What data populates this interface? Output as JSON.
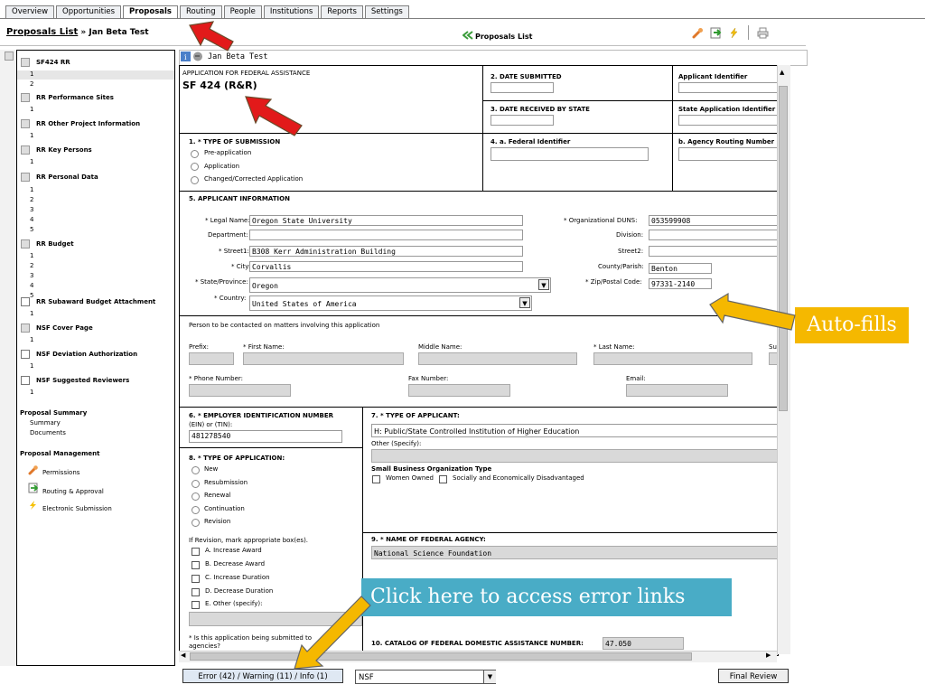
{
  "tabs": [
    "Overview",
    "Opportunities",
    "Proposals",
    "Routing",
    "People",
    "Institutions",
    "Reports",
    "Settings"
  ],
  "active_tab": "Proposals",
  "breadcrumb": {
    "link": "Proposals List",
    "separator": " » ",
    "current": "Jan Beta Test"
  },
  "proposals_link": "Proposals List",
  "proposal_title": "Jan Beta Test",
  "sidebar": {
    "forms": [
      {
        "label": "SF424 RR",
        "rows": [
          "1",
          "2"
        ]
      },
      {
        "label": "RR Performance Sites",
        "rows": [
          "1"
        ]
      },
      {
        "label": "RR Other Project Information",
        "rows": [
          "1"
        ]
      },
      {
        "label": "RR Key Persons",
        "rows": [
          "1"
        ]
      },
      {
        "label": "RR Personal Data",
        "rows": [
          "1",
          "2",
          "3",
          "4",
          "5"
        ]
      },
      {
        "label": "RR Budget",
        "rows": [
          "1",
          "2",
          "3",
          "4",
          "5"
        ]
      },
      {
        "label": "RR Subaward Budget Attachment",
        "rows": [
          "1"
        ]
      },
      {
        "label": "NSF Cover Page",
        "rows": [
          "1"
        ]
      },
      {
        "label": "NSF Deviation Authorization",
        "rows": [
          "1"
        ]
      },
      {
        "label": "NSF Suggested Reviewers",
        "rows": [
          "1"
        ]
      }
    ],
    "summary_title": "Proposal Summary",
    "summary_items": [
      "Summary",
      "Documents"
    ],
    "management_title": "Proposal Management",
    "management_items": [
      "Permissions",
      "Routing & Approval",
      "Electronic Submission"
    ]
  },
  "form": {
    "app_title": "APPLICATION FOR FEDERAL ASSISTANCE",
    "app_form": "SF 424 (R&R)",
    "date_submitted": "2. DATE SUBMITTED",
    "applicant_identifier": "Applicant Identifier",
    "date_received": "3. DATE RECEIVED BY STATE",
    "state_app_id": "State Application Identifier",
    "type_submission": "1. * TYPE OF SUBMISSION",
    "submission_options": [
      "Pre-application",
      "Application",
      "Changed/Corrected Application"
    ],
    "federal_identifier": "4. a. Federal Identifier",
    "agency_routing": "b. Agency Routing Number",
    "applicant_info": "5. APPLICANT INFORMATION",
    "legal_name_label": "* Legal Name:",
    "legal_name": "Oregon State University",
    "department_label": "Department:",
    "street1_label": "* Street1:",
    "street1": "B308 Kerr Administration Building",
    "city_label": "* City:",
    "city": "Corvallis",
    "state_label": "* State/Province:",
    "state": "Oregon",
    "country_label": "* Country:",
    "country": "United States of America",
    "duns_label": "* Organizational DUNS:",
    "duns": "053599908",
    "division_label": "Division:",
    "street2_label": "Street2:",
    "county_label": "County/Parish:",
    "county": "Benton",
    "zip_label": "* Zip/Postal Code:",
    "zip": "97331-2140",
    "contact_title": "Person to be contacted on matters involving this application",
    "prefix_label": "Prefix:",
    "first_label": "* First Name:",
    "middle_label": "Middle Name:",
    "last_label": "* Last Name:",
    "su_label": "Su",
    "phone_label": "* Phone Number:",
    "fax_label": "Fax Number:",
    "email_label": "Email:",
    "ein_title": "6. * EMPLOYER IDENTIFICATION NUMBER",
    "ein_sub": "(EIN) or (TIN):",
    "ein": "481278540",
    "type_applicant": "7. * TYPE OF APPLICANT:",
    "applicant_type": "H: Public/State Controlled Institution of Higher Education",
    "other_specify": "Other (Specify):",
    "small_business": "Small Business Organization Type",
    "women_owned": "Women Owned",
    "disadvantaged": "Socially and Economically Disadvantaged",
    "type_application": "8. * TYPE OF APPLICATION:",
    "application_options": [
      "New",
      "Resubmission",
      "Renewal",
      "Continuation",
      "Revision"
    ],
    "revision_prompt": "If Revision, mark appropriate box(es).",
    "revision_options": [
      "A. Increase Award",
      "B. Decrease Award",
      "C. Increase Duration",
      "D. Decrease Duration",
      "E. Other (specify):"
    ],
    "being_submitted": "* Is this application being submitted to",
    "agencies": "agencies?",
    "federal_agency_title": "9. * NAME OF FEDERAL AGENCY:",
    "federal_agency": "National Science Foundation",
    "catalog_title": "10. CATALOG OF FEDERAL DOMESTIC ASSISTANCE NUMBER:",
    "catalog_number": "47.050"
  },
  "bottom": {
    "error_button": "Error (42) / Warning (11) / Info (1)",
    "agency_select": "NSF",
    "final_review": "Final Review"
  },
  "callouts": {
    "autofills": "Auto-fills",
    "click_here": "Click here to access error links"
  },
  "colors": {
    "callout_orange": "#f5b800",
    "callout_blue": "#49acc6",
    "arrow_red": "#e21a1a",
    "arrow_yellow": "#f5b800"
  },
  "icons": [
    "wrench-icon",
    "export-icon",
    "lightning-icon",
    "print-icon",
    "info-icon",
    "attachment-icon",
    "chevrons-left-icon"
  ]
}
